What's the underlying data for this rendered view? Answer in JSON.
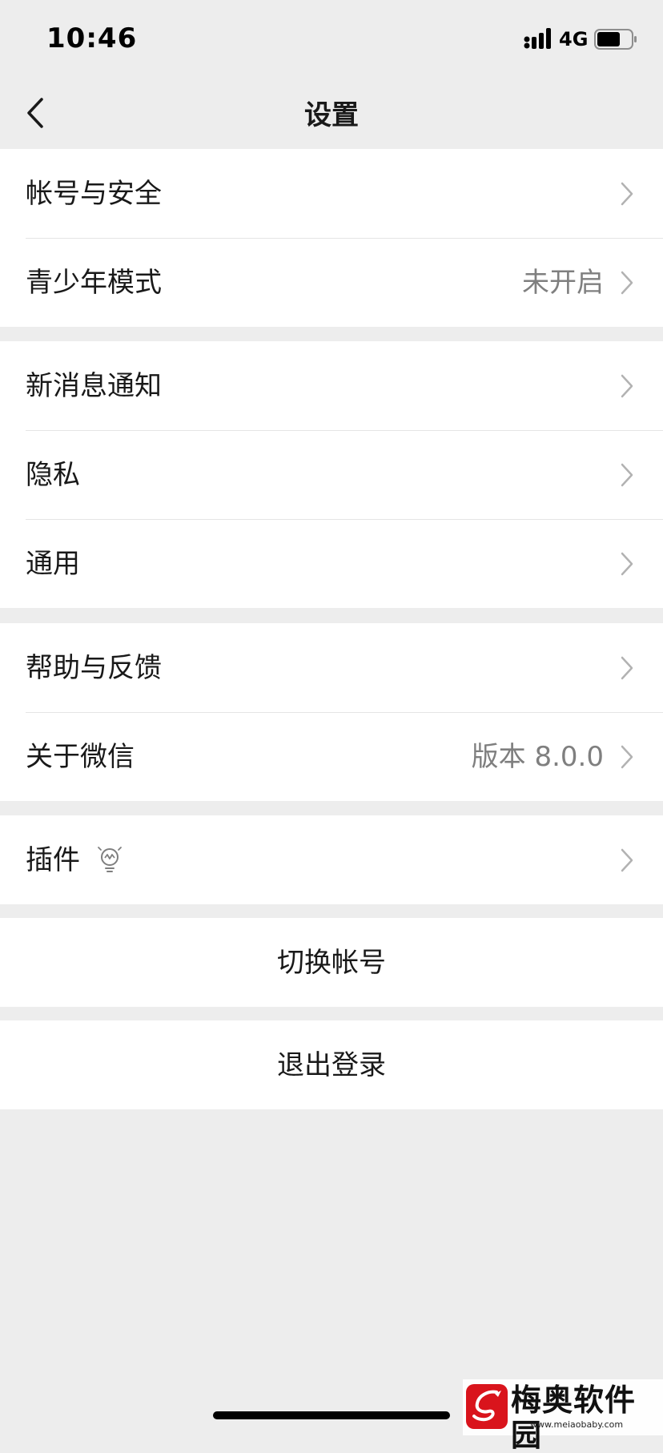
{
  "status_bar": {
    "time": "10:46",
    "network": "4G",
    "icons": [
      "signal-icon",
      "battery-icon"
    ]
  },
  "nav": {
    "title": "设置",
    "back_icon": "back-icon"
  },
  "groups": [
    {
      "items": [
        {
          "label": "帐号与安全",
          "value": ""
        },
        {
          "label": "青少年模式",
          "value": "未开启"
        }
      ]
    },
    {
      "items": [
        {
          "label": "新消息通知",
          "value": ""
        },
        {
          "label": "隐私",
          "value": ""
        },
        {
          "label": "通用",
          "value": ""
        }
      ]
    },
    {
      "items": [
        {
          "label": "帮助与反馈",
          "value": ""
        },
        {
          "label": "关于微信",
          "value": "版本 8.0.0"
        }
      ]
    },
    {
      "items": [
        {
          "label": "插件",
          "value": "",
          "icon": "lightbulb-icon"
        }
      ]
    }
  ],
  "actions": {
    "switch_account": "切换帐号",
    "logout": "退出登录"
  },
  "watermark": {
    "name": "梅奥软件园",
    "url": "www.meiaobaby.com"
  },
  "colors": {
    "background": "#ededed",
    "cell": "#ffffff",
    "separator": "#e5e5e5",
    "secondary_text": "#7f7f7f",
    "chevron": "#b2b2b2",
    "watermark_red": "#d9141c"
  }
}
